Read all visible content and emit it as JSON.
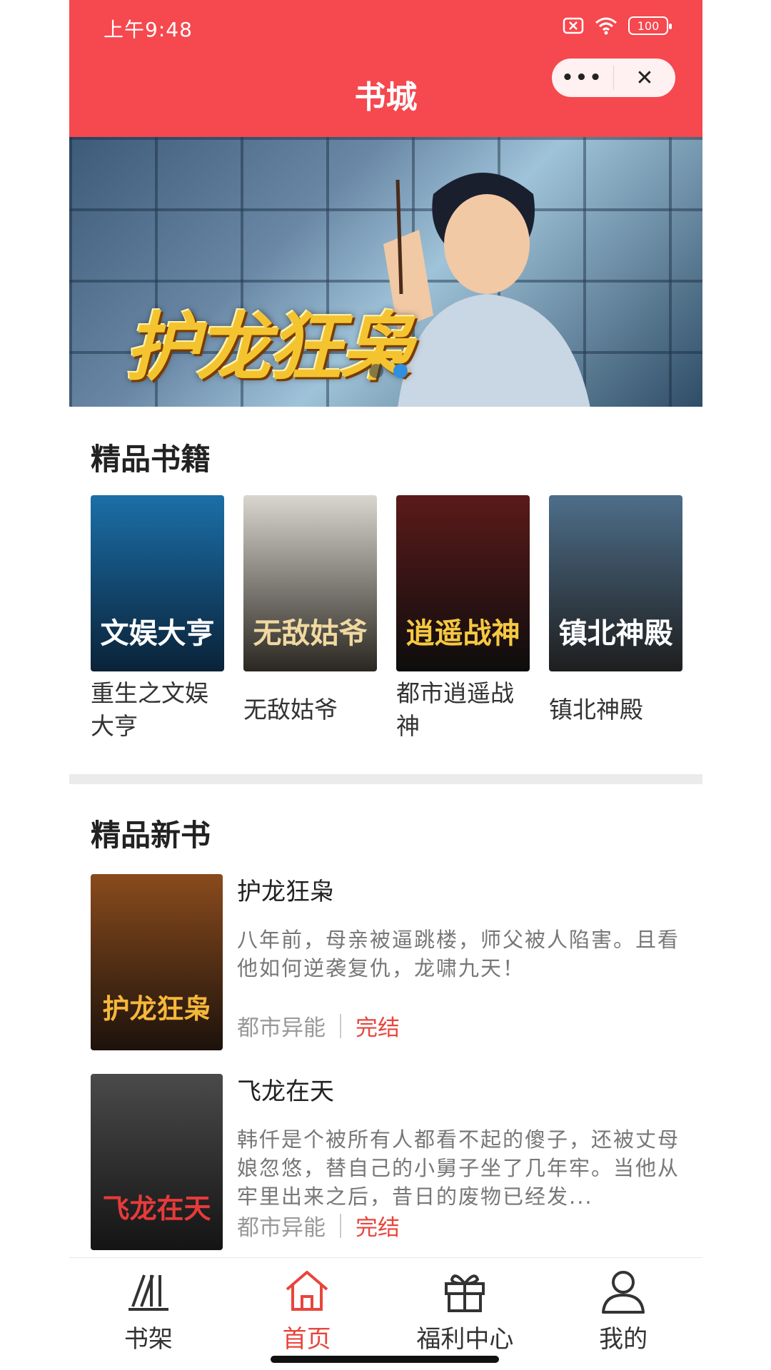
{
  "status_bar": {
    "time": "上午9:48",
    "battery": "100"
  },
  "header": {
    "title": "书城",
    "more_label": "•••",
    "close_label": "✕"
  },
  "banner": {
    "title": "护龙狂枭",
    "dots": 2,
    "active_dot": 1
  },
  "featured": {
    "title": "精品书籍",
    "books": [
      {
        "name": "重生之文娱大亨",
        "cover_text": "文娱大亨",
        "cover_colors": [
          "#1b6fa8",
          "#0a2238"
        ],
        "cover_text_color": "#ffffff"
      },
      {
        "name": "无敌姑爷",
        "cover_text": "无敌姑爷",
        "cover_colors": [
          "#d9d6cf",
          "#2a2620"
        ],
        "cover_text_color": "#f0d9a0"
      },
      {
        "name": "都市逍遥战神",
        "cover_text": "逍遥战神",
        "cover_colors": [
          "#5b1a1a",
          "#0d0d0d"
        ],
        "cover_text_color": "#f5c842"
      },
      {
        "name": "镇北神殿",
        "cover_text": "镇北神殿",
        "cover_colors": [
          "#4d6e8a",
          "#1e1e1e"
        ],
        "cover_text_color": "#ffffff"
      }
    ]
  },
  "new_books": {
    "title": "精品新书",
    "items": [
      {
        "name": "护龙狂枭",
        "desc": "八年前，母亲被逼跳楼，师父被人陷害。且看他如何逆袭复仇，龙啸九天！",
        "category": "都市异能",
        "status": "完结",
        "cover_text": "护龙狂枭",
        "cover_colors": [
          "#8a4b1d",
          "#1c120c"
        ],
        "cover_text_color": "#f5b73a"
      },
      {
        "name": "飞龙在天",
        "desc": "韩仟是个被所有人都看不起的傻子，还被丈母娘忽悠，替自己的小舅子坐了几年牢。当他从牢里出来之后，昔日的废物已经发...",
        "category": "都市异能",
        "status": "完结",
        "cover_text": "飞龙在天",
        "cover_colors": [
          "#4a4a4a",
          "#141414"
        ],
        "cover_text_color": "#e83a3a"
      }
    ]
  },
  "tabbar": {
    "tabs": [
      {
        "label": "书架",
        "icon": "bookshelf-icon"
      },
      {
        "label": "首页",
        "icon": "home-icon"
      },
      {
        "label": "福利中心",
        "icon": "gift-icon"
      },
      {
        "label": "我的",
        "icon": "user-icon"
      }
    ],
    "active": 1
  },
  "colors": {
    "brand": "#f5484f",
    "accent": "#e8453c"
  }
}
